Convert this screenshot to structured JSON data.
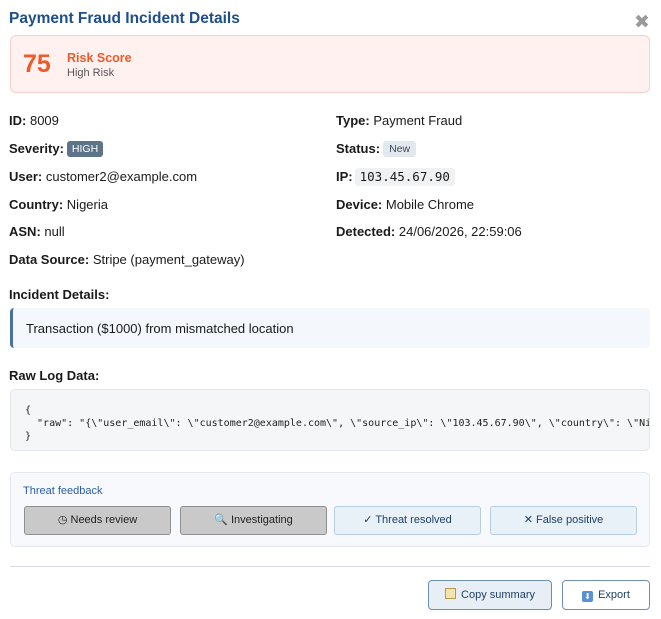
{
  "dialog": {
    "title": "Payment Fraud Incident Details",
    "close_glyph": "✖"
  },
  "risk": {
    "score": "75",
    "label": "Risk Score",
    "level": "High Risk"
  },
  "fields": {
    "id_label": "ID:",
    "id_value": "8009",
    "type_label": "Type:",
    "type_value": "Payment Fraud",
    "severity_label": "Severity:",
    "severity_value": "HIGH",
    "status_label": "Status:",
    "status_value": "New",
    "user_label": "User:",
    "user_value": "customer2@example.com",
    "ip_label": "IP:",
    "ip_value": "103.45.67.90",
    "country_label": "Country:",
    "country_value": "Nigeria",
    "device_label": "Device:",
    "device_value": "Mobile Chrome",
    "asn_label": "ASN:",
    "asn_value": "null",
    "detected_label": "Detected:",
    "detected_value": "24/06/2026, 22:59:06",
    "source_label": "Data Source:",
    "source_value": "Stripe (payment_gateway)"
  },
  "incident": {
    "heading": "Incident Details:",
    "text": "Transaction ($1000) from mismatched location"
  },
  "raw_log": {
    "heading": "Raw Log Data:",
    "text": "{\n  \"raw\": \"{\\\"user_email\\\": \\\"customer2@example.com\\\", \\\"source_ip\\\": \\\"103.45.67.90\\\", \\\"country\\\": \\\"Nig\n}"
  },
  "feedback": {
    "title": "Threat feedback",
    "buttons": [
      "◷ Needs review",
      "🔍 Investigating",
      "✓ Threat resolved",
      "✕ False positive"
    ]
  },
  "actions": {
    "copy_label": "Copy summary",
    "export_label": "Export"
  },
  "colors": {
    "accent": "#1f4e8c",
    "risk": "#ef5a2b",
    "badge_high": "#5e7489"
  }
}
